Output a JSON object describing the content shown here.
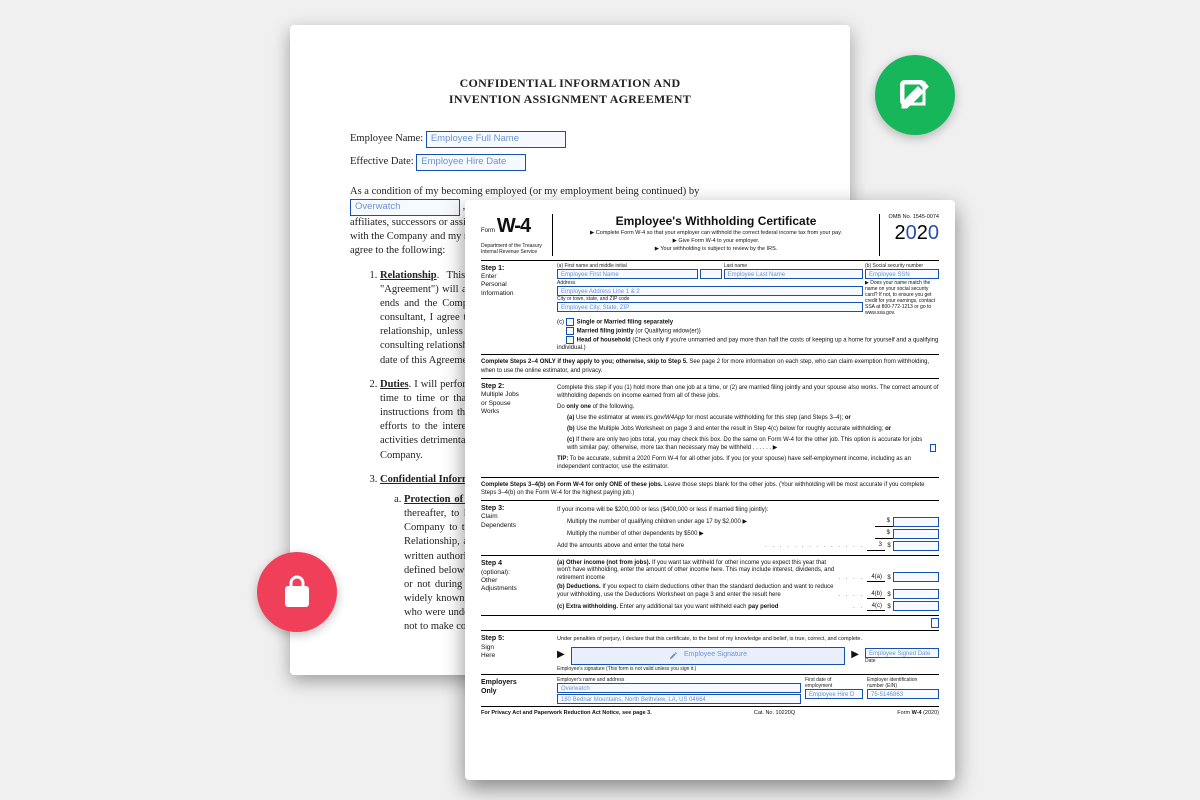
{
  "badge_green_name": "edit-icon",
  "badge_red_name": "lock-icon",
  "back_doc": {
    "title_l1": "CONFIDENTIAL INFORMATION AND",
    "title_l2": "INVENTION ASSIGNMENT AGREEMENT",
    "name_label": "Employee Name:",
    "name_fill": "Employee Full Name",
    "date_label": "Effective Date:",
    "date_fill": "Employee Hire Date",
    "intro_pre": "As a condition of my becoming employed (or my employment being continued) by",
    "company_fill": "Overwatch",
    "intro_post": ", a Delaware corporation, or any of its current or future subsidiaries, affiliates, successors or assigns (collectively, the \"Company\"), and in consideration of my employment with the Company and my receipt of the compensation now and hereafter paid to me by the Company, I agree to the following:",
    "item1_head": "Relationship",
    "item1_body": ". This Confidential Information and Invention Assignment Agreement (this \"Agreement\") will apply to my employment relationship with the Company. If that relationship ends and the Company, within a year thereafter, either re-employs me or engages me as a consultant, I agree that this Agreement will also apply to such later employment or consulting relationship, unless the Company and I otherwise agree in writing. Any such employment or consulting relationship between the parties hereto, whether commenced prior to, upon or after the date of this Agreement, is referred to herein as the \"Relationship.\"",
    "item2_head": "Duties",
    "item2_body": ". I will perform for the Company such duties as may be designated by the Company from time to time or that are otherwise within the scope of the Relationship and not contrary to instructions from the Company. During the Relationship, I will devote my entire best business efforts to the interests of the Company and will not engage in other employment or in any activities detrimental to the best interests of the Company without the prior written consent of the Company.",
    "item3_head": "Confidential Information",
    "item3a_head": "Protection of Information",
    "item3a_body": ". I agree, at all times during the term of the Relationship and thereafter, to hold in strictest confidence, and not to use, except for the benefit of the Company to the extent necessary to perform my obligations to the Company under the Relationship, and not to disclose to any person, firm, corporation or other entity, without written authorization from the Company in each instance, any Confidential Information (as defined below) that I obtain, access or create during the term of the Relationship, whether or not during working hours, until such Confidential Information becomes publicly and widely known and made generally available through no wrongful act of mine or of others who were under confidentiality obligations as to the item or items involved. I further agree not to make copies of such Confidential Information except as authorized by the Company."
  },
  "w4": {
    "form_label": "Form",
    "form_no": "W-4",
    "dept": "Department of the Treasury\nInternal Revenue Service",
    "title": "Employee's Withholding Certificate",
    "sub1": "▶ Complete Form W-4 so that your employer can withhold the correct federal income tax from your pay.",
    "sub2": "▶ Give Form W-4 to your employer.",
    "sub3": "▶ Your withholding is subject to review by the IRS.",
    "omb": "OMB No. 1545-0074",
    "year": "2020",
    "step1_label": "Step 1:\nEnter\nPersonal\nInformation",
    "step1": {
      "a_label": "(a)  First name and middle initial",
      "first_name": "Employee First Name",
      "mi": "",
      "last_label": "Last name",
      "last_name": "Employee Last Name",
      "b_label": "(b)  Social security number",
      "ssn": "Employee SSN",
      "addr_label": "Address",
      "addr": "Employee Address Line 1 & 2",
      "city_label": "City or town, state, and ZIP code",
      "city": "Employee City, State, ZIP",
      "side_note": "▶ Does your name match the name on your social security card? If not, to ensure you get credit for your earnings, contact SSA at 800-772-1213 or go to www.ssa.gov.",
      "c_label": "(c)",
      "c1": "Single or Married filing separately",
      "c2": "Married filing jointly (or Qualifying widow(er))",
      "c3": "Head of household (Check only if you're unmarried and pay more than half the costs of keeping up a home for yourself and a qualifying individual.)"
    },
    "note24": "Complete Steps 2–4 ONLY if they apply to you; otherwise, skip to Step 5. See page 2 for more information on each step, who can claim exemption from withholding, when to use the online estimator, and privacy.",
    "step2_label": "Step 2:\nMultiple Jobs\nor Spouse\nWorks",
    "step2": {
      "p1": "Complete this step if you (1) hold more than one job at a time, or (2) are married filing jointly and your spouse also works. The correct amount of withholding depends on income earned from all of these jobs.",
      "p2": "Do only one of the following.",
      "a": "(a) Use the estimator at www.irs.gov/W4App for most accurate withholding for this step (and Steps 3–4); or",
      "b": "(b) Use the Multiple Jobs Worksheet on page 3 and enter the result in Step 4(c) below for roughly accurate withholding; or",
      "c": "(c) If there are only two jobs total, you may check this box. Do the same on Form W-4 for the other job. This option is accurate for jobs with similar pay; otherwise, more tax than necessary may be withheld",
      "tip": "TIP: To be accurate, submit a 2020 Form W-4 for all other jobs. If you (or your spouse) have self-employment income, including as an independent contractor, use the estimator."
    },
    "note34": "Complete Steps 3–4(b) on Form W-4 for only ONE of these jobs. Leave those steps blank for the other jobs. (Your withholding will be most accurate if you complete Steps 3–4(b) on the Form W-4 for the highest paying job.)",
    "step3_label": "Step 3:\nClaim\nDependents",
    "step3": {
      "intro": "If your income will be $200,000 or less ($400,000 or less if married filing jointly):",
      "l1": "Multiply the number of qualifying children under age 17 by $2,000  ▶",
      "l2": "Multiply the number of other dependents by $500          ▶",
      "l3": "Add the amounts above and enter the total here",
      "l3_num": "3"
    },
    "step4_label": "Step 4\n(optional):\nOther\nAdjustments",
    "step4": {
      "a": "(a) Other income (not from jobs). If you want tax withheld for other income you expect this year that won't have withholding, enter the amount of other income here. This may include interest, dividends, and retirement income",
      "a_num": "4(a)",
      "b": "(b) Deductions. If you expect to claim deductions other than the standard deduction and want to reduce your withholding, use the Deductions Worksheet on page 3 and enter the result here",
      "b_num": "4(b)",
      "c": "(c) Extra withholding. Enter any additional tax you want withheld each pay period",
      "c_num": "4(c)"
    },
    "step5_label": "Step 5:\nSign\nHere",
    "step5": {
      "oath": "Under penalties of perjury, I declare that this certificate, to the best of my knowledge and belief, is true, correct, and complete.",
      "sig_label": "Employee Signature",
      "sig_sub": "Employee's signature (This form is not valid unless you sign it.)",
      "date_label": "Date",
      "date_fill": "Employee Signed Date"
    },
    "employers_label": "Employers\nOnly",
    "employers": {
      "name_label": "Employer's name and address",
      "name": "Overwatch",
      "addr": "180 Bednar Mountains, North Bethview, LA, US 04664",
      "first_date_label": "First date of\nemployment",
      "first_date": "Employee Hire D",
      "ein_label": "Employer identification\nnumber (EIN)",
      "ein": "75-5146863"
    },
    "footer_left": "For Privacy Act and Paperwork Reduction Act Notice, see page 3.",
    "footer_mid": "Cat. No. 10220Q",
    "footer_right": "Form W-4 (2020)"
  }
}
